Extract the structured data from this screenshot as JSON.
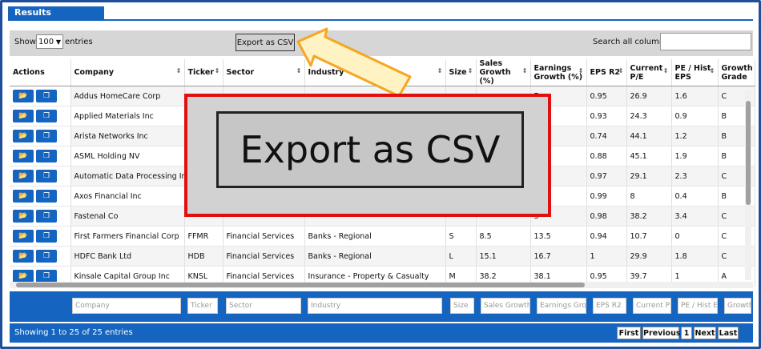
{
  "panel": {
    "title": "Results"
  },
  "toolbar": {
    "show_label": "Show",
    "page_size": "100",
    "entries_label": "entries",
    "export_label": "Export as CSV",
    "search_label": "Search all columns:",
    "search_value": ""
  },
  "columns": [
    "Actions",
    "Company",
    "Ticker",
    "Sector",
    "Industry",
    "Size",
    "Sales Growth (%)",
    "Earnings Growth (%)",
    "EPS R2",
    "Current P/E",
    "PE / Hist EPS",
    "Growth Grade"
  ],
  "rows": [
    {
      "company": "Addus HomeCare Corp",
      "ticker": "",
      "sector": "",
      "industry": "",
      "size": "",
      "sales": "",
      "earnings": "7",
      "eps": "0.95",
      "pe": "26.9",
      "pehist": "1.6",
      "grade": "C"
    },
    {
      "company": "Applied Materials Inc",
      "ticker": "",
      "sector": "",
      "industry": "",
      "size": "",
      "sales": "",
      "earnings": "2",
      "eps": "0.93",
      "pe": "24.3",
      "pehist": "0.9",
      "grade": "B"
    },
    {
      "company": "Arista Networks Inc",
      "ticker": "",
      "sector": "",
      "industry": "",
      "size": "",
      "sales": "",
      "earnings": "7",
      "eps": "0.74",
      "pe": "44.1",
      "pehist": "1.2",
      "grade": "B"
    },
    {
      "company": "ASML Holding NV",
      "ticker": "",
      "sector": "",
      "industry": "",
      "size": "",
      "sales": "",
      "earnings": "3",
      "eps": "0.88",
      "pe": "45.1",
      "pehist": "1.9",
      "grade": "B"
    },
    {
      "company": "Automatic Data Processing Inc",
      "ticker": "",
      "sector": "",
      "industry": "",
      "size": "",
      "sales": "",
      "earnings": "5",
      "eps": "0.97",
      "pe": "29.1",
      "pehist": "2.3",
      "grade": "C"
    },
    {
      "company": "Axos Financial Inc",
      "ticker": "",
      "sector": "",
      "industry": "",
      "size": "",
      "sales": "",
      "earnings": "7",
      "eps": "0.99",
      "pe": "8",
      "pehist": "0.4",
      "grade": "B"
    },
    {
      "company": "Fastenal Co",
      "ticker": "",
      "sector": "",
      "industry": "",
      "size": "",
      "sales": "",
      "earnings": "3",
      "eps": "0.98",
      "pe": "38.2",
      "pehist": "3.4",
      "grade": "C"
    },
    {
      "company": "First Farmers Financial Corp",
      "ticker": "FFMR",
      "sector": "Financial Services",
      "industry": "Banks - Regional",
      "size": "S",
      "sales": "8.5",
      "earnings": "13.5",
      "eps": "0.94",
      "pe": "10.7",
      "pehist": "0",
      "grade": "C"
    },
    {
      "company": "HDFC Bank Ltd",
      "ticker": "HDB",
      "sector": "Financial Services",
      "industry": "Banks - Regional",
      "size": "L",
      "sales": "15.1",
      "earnings": "16.7",
      "eps": "1",
      "pe": "29.9",
      "pehist": "1.8",
      "grade": "C"
    },
    {
      "company": "Kinsale Capital Group Inc",
      "ticker": "KNSL",
      "sector": "Financial Services",
      "industry": "Insurance - Property & Casualty",
      "size": "M",
      "sales": "38.2",
      "earnings": "38.1",
      "eps": "0.95",
      "pe": "39.7",
      "pehist": "1",
      "grade": "A"
    }
  ],
  "filters": [
    "Company",
    "Ticker",
    "Sector",
    "Industry",
    "Size",
    "Sales Growth",
    "Earnings Gro",
    "EPS R2",
    "Current P",
    "PE / Hist E",
    "Growth"
  ],
  "footer": {
    "showing": "Showing 1 to 25 of 25 entries",
    "first": "First",
    "previous": "Previous",
    "page": "1",
    "next": "Next",
    "last": "Last"
  },
  "callout": {
    "label": "Export as CSV",
    "arrow_color": "#f5a623",
    "box_color": "#e01010"
  },
  "icons": {
    "open": "folder-open-icon",
    "details": "window-icon"
  },
  "colors": {
    "accent": "#1565c0"
  }
}
